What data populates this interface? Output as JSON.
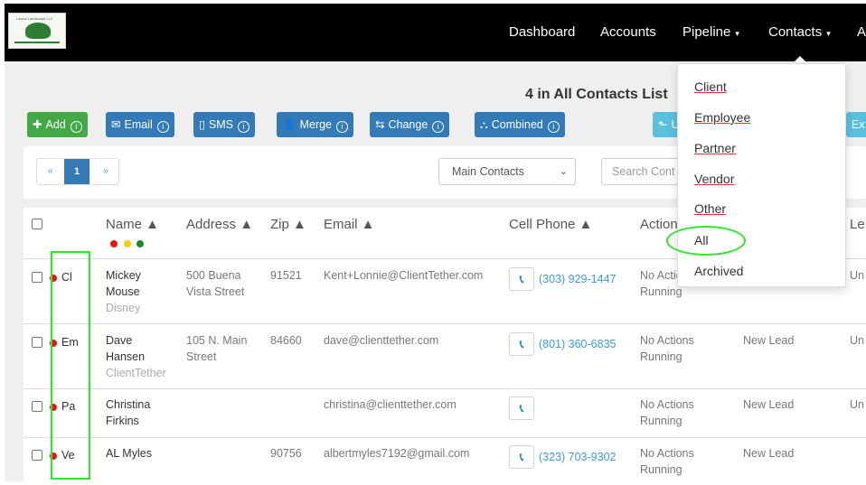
{
  "nav": {
    "logo_text": "Lawns Landscape LLC",
    "items": [
      {
        "label": "Dashboard",
        "caret": false
      },
      {
        "label": "Accounts",
        "caret": false
      },
      {
        "label": "Pipeline",
        "caret": true
      },
      {
        "label": "Contacts",
        "caret": true
      },
      {
        "label": "A",
        "caret": false
      }
    ],
    "caret_glyph": "▾"
  },
  "heading": "4 in All Contacts List",
  "toolbar": {
    "add": "Add",
    "email": "Email",
    "sms": "SMS",
    "merge": "Merge",
    "change": "Change",
    "combined": "Combined",
    "upload_partial": "U",
    "export_partial": "Ex",
    "info_glyph": "i"
  },
  "pager": {
    "prev": "«",
    "page": "1",
    "next": "»"
  },
  "filter": {
    "selected": "Main Contacts",
    "search_placeholder": "Search Cont"
  },
  "table": {
    "headers": [
      "Name ▲",
      "Address ▲",
      "Zip ▲",
      "Email ▲",
      "Cell Phone ▲",
      "Action",
      "Le"
    ],
    "legend_colors": [
      "#e11",
      "#f5d000",
      "#1d8a2a"
    ],
    "rows": [
      {
        "type": "Cl",
        "first": "Mickey",
        "last": "Mouse",
        "company": "Disney",
        "addr1": "500 Buena",
        "addr2": "Vista Street",
        "zip": "91521",
        "email": "Kent+Lonnie@ClientTether.com",
        "phone": "(303) 929-1447",
        "action1": "No Actio",
        "action2": "Running",
        "status": "",
        "lead": "Un"
      },
      {
        "type": "Em",
        "first": "Dave",
        "last": "Hansen",
        "company": "ClientTether",
        "addr1": "105 N. Main",
        "addr2": "Street",
        "zip": "84660",
        "email": "dave@clienttether.com",
        "phone": "(801) 360-6835",
        "action1": "No Actions",
        "action2": "Running",
        "status": "New Lead",
        "lead": "Un"
      },
      {
        "type": "Pa",
        "first": "Christina",
        "last": "Firkins",
        "company": "",
        "addr1": "",
        "addr2": "",
        "zip": "",
        "email": "christina@clienttether.com",
        "phone": "",
        "action1": "No Actions",
        "action2": "Running",
        "status": "New Lead",
        "lead": "Un"
      },
      {
        "type": "Ve",
        "first": "AL Myles",
        "last": "",
        "company": "",
        "addr1": "",
        "addr2": "",
        "zip": "90756",
        "email": "albertmyles7192@gmail.com",
        "phone": "(323) 703-9302",
        "action1": "No Actions",
        "action2": "Running",
        "status": "New Lead",
        "lead": ""
      }
    ]
  },
  "contacts_menu": {
    "items": [
      "Client",
      "Employee",
      "Partner",
      "Vendor",
      "Other",
      "All",
      "Archived"
    ]
  },
  "colors": {
    "green_button": "#44a846",
    "blue_button": "#337ab7",
    "highlight": "#2ee62e"
  }
}
